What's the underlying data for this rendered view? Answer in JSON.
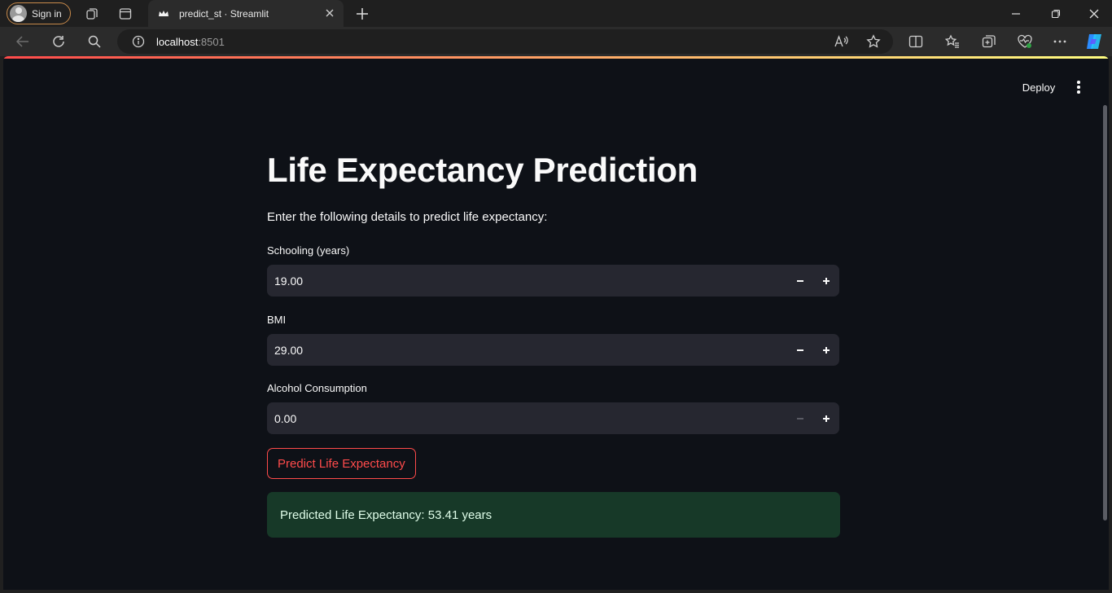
{
  "browser": {
    "signin_label": "Sign in",
    "tab_title": "predict_st · Streamlit",
    "url_host": "localhost",
    "url_port": ":8501"
  },
  "header": {
    "deploy_label": "Deploy"
  },
  "main": {
    "title": "Life Expectancy Prediction",
    "intro": "Enter the following details to predict life expectancy:",
    "inputs": [
      {
        "label": "Schooling (years)",
        "value": "19.00",
        "minus_enabled": true
      },
      {
        "label": "BMI",
        "value": "29.00",
        "minus_enabled": true
      },
      {
        "label": "Alcohol Consumption",
        "value": "0.00",
        "minus_enabled": false
      }
    ],
    "predict_button": "Predict Life Expectancy",
    "result": "Predicted Life Expectancy: 53.41 years"
  },
  "colors": {
    "background": "#0e1117",
    "input_bg": "#262730",
    "primary": "#ff4b4b",
    "success_bg": "#173928"
  }
}
